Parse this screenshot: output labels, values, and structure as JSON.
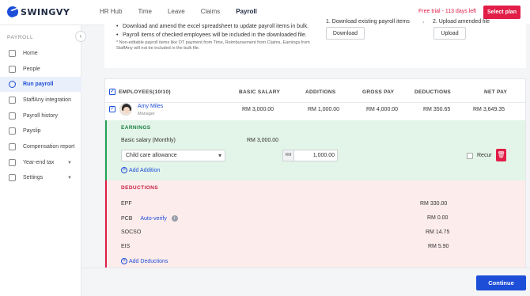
{
  "brand": {
    "logo_text": "SWINGVY",
    "accent": "#1d4ed8",
    "danger": "#e11d48"
  },
  "topnav": {
    "items": [
      "HR Hub",
      "Time",
      "Leave",
      "Claims",
      "Payroll"
    ],
    "active": "Payroll",
    "trial_text": "Free trial - 113 days left",
    "select_plan": "Select plan"
  },
  "sidebar": {
    "title": "PAYROLL",
    "items": [
      {
        "label": "Home",
        "icon": "home-icon"
      },
      {
        "label": "People",
        "icon": "people-icon"
      },
      {
        "label": "Run payroll",
        "icon": "run-payroll-icon",
        "active": true
      },
      {
        "label": "StaffAny integration",
        "icon": "integration-icon"
      },
      {
        "label": "Payroll history",
        "icon": "history-icon"
      },
      {
        "label": "Payslip",
        "icon": "payslip-icon"
      },
      {
        "label": "Compensation report",
        "icon": "report-icon"
      },
      {
        "label": "Year-end tax",
        "icon": "tax-icon",
        "expandable": true
      },
      {
        "label": "Settings",
        "icon": "settings-icon",
        "expandable": true
      }
    ]
  },
  "upload": {
    "bullets": [
      "Download and amend the excel spreadsheet to update payroll items in bulk.",
      "Payroll items of checked employees will be included in the downloaded file."
    ],
    "note": "* Non-editable payroll items like OT payment from Time, Reimbursement from Claims, Earnings from StaffAny will not be included in the bulk file.",
    "step1": "1. Download existing payroll items",
    "step2": "2. Upload amended file",
    "download_btn": "Download",
    "upload_btn": "Upload"
  },
  "table": {
    "headers": {
      "employees": "EMPLOYEES(10/10)",
      "basic_salary": "BASIC SALARY",
      "additions": "ADDITIONS",
      "gross_pay": "GROSS PAY",
      "deductions": "DEDUCTIONS",
      "net_pay": "NET PAY"
    },
    "employee": {
      "name": "Amy Miles",
      "role": "Manager",
      "basic_salary": "RM 3,000.00",
      "additions": "RM 1,000.00",
      "gross_pay": "RM 4,000.00",
      "deductions": "RM 350.65",
      "net_pay": "RM 3,649.35"
    },
    "earnings": {
      "title": "EARNINGS",
      "basic_label": "Basic salary (Monthly)",
      "basic_value": "RM 3,000.00",
      "allowance_selected": "Child care allowance",
      "currency_prefix": "RM",
      "allowance_amount": "1,000.00",
      "recur_label": "Recur",
      "add_label": "Add Addition"
    },
    "deductions": {
      "title": "DEDUCTIONS",
      "epf_label": "EPF",
      "epf_value": "RM 330.00",
      "pcb_label": "PCB",
      "pcb_autoverify": "Auto-verify",
      "pcb_value": "RM 0.00",
      "socso_label": "SOCSO",
      "socso_value": "RM 14.75",
      "eis_label": "EIS",
      "eis_value": "RM 5.90",
      "add_label": "Add Deductions"
    }
  },
  "footer": {
    "continue": "Continue"
  }
}
